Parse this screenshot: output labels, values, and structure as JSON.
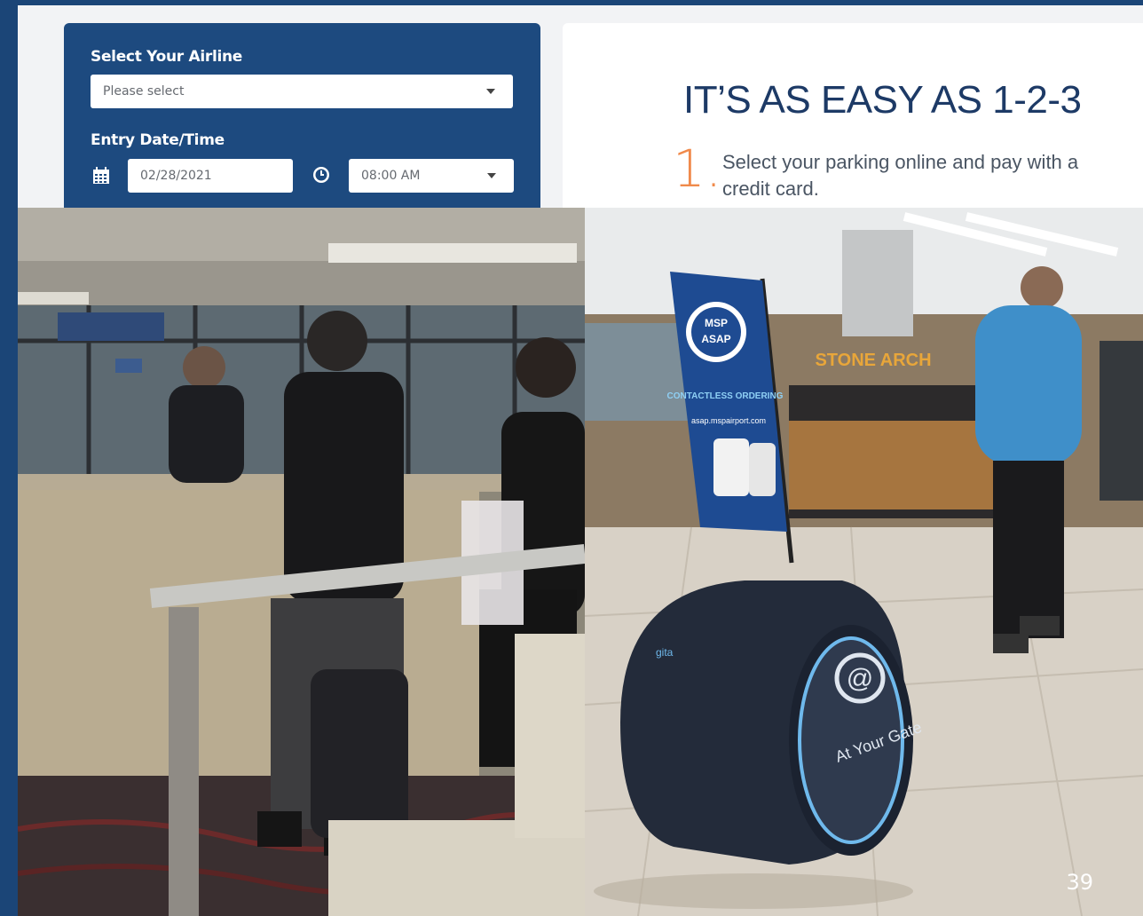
{
  "form": {
    "airline_label": "Select Your Airline",
    "airline_placeholder": "Please select",
    "entry_label": "Entry Date/Time",
    "entry_date": "02/28/2021",
    "entry_time": "08:00 AM"
  },
  "promo": {
    "title": "IT’S AS EASY AS 1-2-3",
    "step_number": "1.",
    "step_text": "Select your parking online and pay with a credit card."
  },
  "photo_right": {
    "flag_line1": "MSP",
    "flag_line2": "ASAP",
    "flag_line3": "CONTACTLESS ORDERING",
    "flag_url": "asap.mspairport.com",
    "store_sign": "STONE ARCH",
    "robot_brand": "At Your Gate",
    "robot_maker": "gita"
  },
  "page_number": "39",
  "colors": {
    "background": "#1b4577",
    "panel": "#1d4a7f",
    "title": "#1d3a66",
    "step_accent": "#f08a4b"
  }
}
